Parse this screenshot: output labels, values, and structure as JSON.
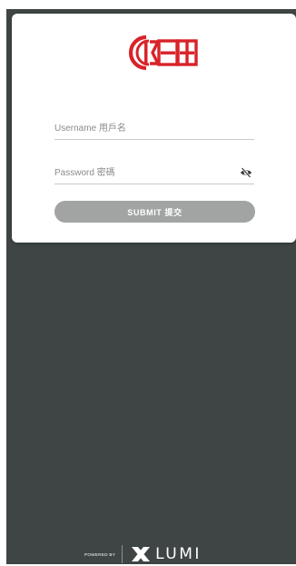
{
  "login": {
    "username_placeholder": "Username 用戶名",
    "password_placeholder": "Password 密碼",
    "submit_label": "SUBMIT 提交"
  },
  "footer": {
    "powered_by": "POWERED BY",
    "brand": "LUMI"
  },
  "colors": {
    "background": "#3e4544",
    "card": "#ffffff",
    "logo_red": "#d8232a",
    "button": "#a2a3a3"
  },
  "icons": {
    "logo": "ckh-logo",
    "password_toggle": "eye-slash-icon",
    "lumi_mark": "lumi-x-icon"
  }
}
